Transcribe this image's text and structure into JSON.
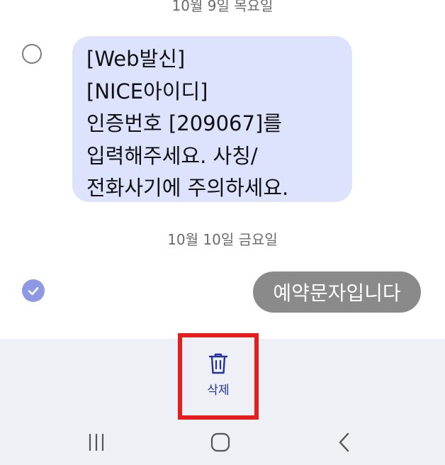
{
  "dates": {
    "top": "10월 9일 목요일",
    "mid": "10월 10일 금요일"
  },
  "messages": [
    {
      "lines": [
        "[Web발신]",
        "[NICE아이디]",
        "인증번호 [209067]를",
        "입력해주세요. 사칭/",
        "전화사기에 주의하세요."
      ],
      "selected": false
    },
    {
      "text": "예약문자입니다",
      "selected": true
    }
  ],
  "actions": {
    "delete_label": "삭제",
    "delete_icon": "trash-icon"
  },
  "colors": {
    "incoming_bubble": "#dde2fd",
    "outgoing_bubble": "#8a8a8a",
    "selected_check": "#8e99e6",
    "delete_label": "#24329a",
    "highlight_border": "#e51d1d"
  }
}
